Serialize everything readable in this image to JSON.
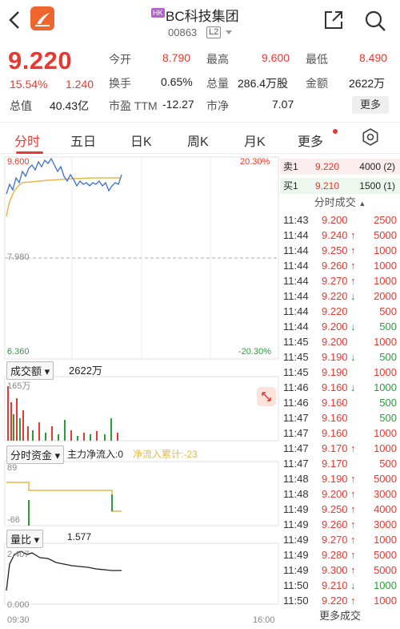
{
  "header": {
    "market_badge": "HK",
    "name": "BC科技集团",
    "code": "00863",
    "level": "L2"
  },
  "quote": {
    "price": "9.220",
    "change_pct": "15.54%",
    "change": "1.240",
    "market_cap_label": "总值",
    "market_cap": "40.43亿",
    "stats": [
      {
        "label": "今开",
        "value": "8.790"
      },
      {
        "label": "最高",
        "value": "9.600"
      },
      {
        "label": "最低",
        "value": "8.490"
      },
      {
        "label": "换手",
        "value": "0.65%"
      },
      {
        "label": "总量",
        "value": "286.4万股"
      },
      {
        "label": "金额",
        "value": "2622万"
      },
      {
        "label": "市盈 TTM",
        "value": "-12.27"
      },
      {
        "label": "市净",
        "value": "7.07"
      }
    ],
    "more_button": "更多"
  },
  "tabs": [
    "分时",
    "五日",
    "日K",
    "周K",
    "月K",
    "更多"
  ],
  "active_tab": "分时",
  "chart_labels": {
    "high": "9.600",
    "high_pct": "20.30%",
    "mid": "7.980",
    "low": "6.360",
    "low_pct": "-20.30%",
    "volume_panel": "成交额",
    "volume_value": "2622万",
    "volume_max": "165万",
    "flow_panel": "分时资金",
    "flow_main_label": "主力净流入:0",
    "flow_cum_label": "净流入累计:-23",
    "flow_top": "89",
    "flow_bottom": "-66",
    "ratio_panel": "量比",
    "ratio_value": "1.577",
    "ratio_top": "2.407",
    "ratio_bottom": "0.000",
    "time_start": "09:30",
    "time_end": "16:00"
  },
  "order_book": {
    "sell": {
      "label": "卖1",
      "price": "9.220",
      "volume": "4000 (2)"
    },
    "buy": {
      "label": "买1",
      "price": "9.210",
      "volume": "1500 (1)"
    },
    "trades_header": "分时成交"
  },
  "trades": [
    {
      "time": "11:43",
      "price": "9.200",
      "dir": "",
      "volume": "2500",
      "color": "red"
    },
    {
      "time": "11:44",
      "price": "9.240",
      "dir": "↑",
      "volume": "5000",
      "color": "red"
    },
    {
      "time": "11:44",
      "price": "9.250",
      "dir": "↑",
      "volume": "1000",
      "color": "red"
    },
    {
      "time": "11:44",
      "price": "9.260",
      "dir": "↑",
      "volume": "1000",
      "color": "red"
    },
    {
      "time": "11:44",
      "price": "9.270",
      "dir": "↑",
      "volume": "1000",
      "color": "red"
    },
    {
      "time": "11:44",
      "price": "9.220",
      "dir": "↓",
      "volume": "2000",
      "color": "red"
    },
    {
      "time": "11:44",
      "price": "9.220",
      "dir": "",
      "volume": "500",
      "color": "red"
    },
    {
      "time": "11:44",
      "price": "9.200",
      "dir": "↓",
      "volume": "500",
      "color": "green"
    },
    {
      "time": "11:45",
      "price": "9.200",
      "dir": "",
      "volume": "1000",
      "color": "red"
    },
    {
      "time": "11:45",
      "price": "9.190",
      "dir": "↓",
      "volume": "500",
      "color": "green"
    },
    {
      "time": "11:45",
      "price": "9.190",
      "dir": "",
      "volume": "1000",
      "color": "red"
    },
    {
      "time": "11:46",
      "price": "9.160",
      "dir": "↓",
      "volume": "1000",
      "color": "green"
    },
    {
      "time": "11:46",
      "price": "9.160",
      "dir": "",
      "volume": "500",
      "color": "green"
    },
    {
      "time": "11:47",
      "price": "9.160",
      "dir": "",
      "volume": "500",
      "color": "green"
    },
    {
      "time": "11:47",
      "price": "9.160",
      "dir": "",
      "volume": "1000",
      "color": "red"
    },
    {
      "time": "11:47",
      "price": "9.170",
      "dir": "↑",
      "volume": "1000",
      "color": "red"
    },
    {
      "time": "11:47",
      "price": "9.170",
      "dir": "",
      "volume": "500",
      "color": "red"
    },
    {
      "time": "11:48",
      "price": "9.190",
      "dir": "↑",
      "volume": "5000",
      "color": "red"
    },
    {
      "time": "11:48",
      "price": "9.200",
      "dir": "↑",
      "volume": "3000",
      "color": "red"
    },
    {
      "time": "11:49",
      "price": "9.250",
      "dir": "↑",
      "volume": "4000",
      "color": "red"
    },
    {
      "time": "11:49",
      "price": "9.260",
      "dir": "↑",
      "volume": "3000",
      "color": "red"
    },
    {
      "time": "11:49",
      "price": "9.270",
      "dir": "↑",
      "volume": "1000",
      "color": "red"
    },
    {
      "time": "11:49",
      "price": "9.280",
      "dir": "↑",
      "volume": "5000",
      "color": "red"
    },
    {
      "time": "11:49",
      "price": "9.300",
      "dir": "↑",
      "volume": "5000",
      "color": "red"
    },
    {
      "time": "11:50",
      "price": "9.210",
      "dir": "↓",
      "volume": "1000",
      "color": "green"
    },
    {
      "time": "11:50",
      "price": "9.220",
      "dir": "↑",
      "volume": "1000",
      "color": "red"
    }
  ],
  "more_trades": "更多成交",
  "colors": {
    "up": "#e8382f",
    "down": "#2a9d3a",
    "avg": "#e6b84a",
    "price_line": "#3a6fcf"
  }
}
